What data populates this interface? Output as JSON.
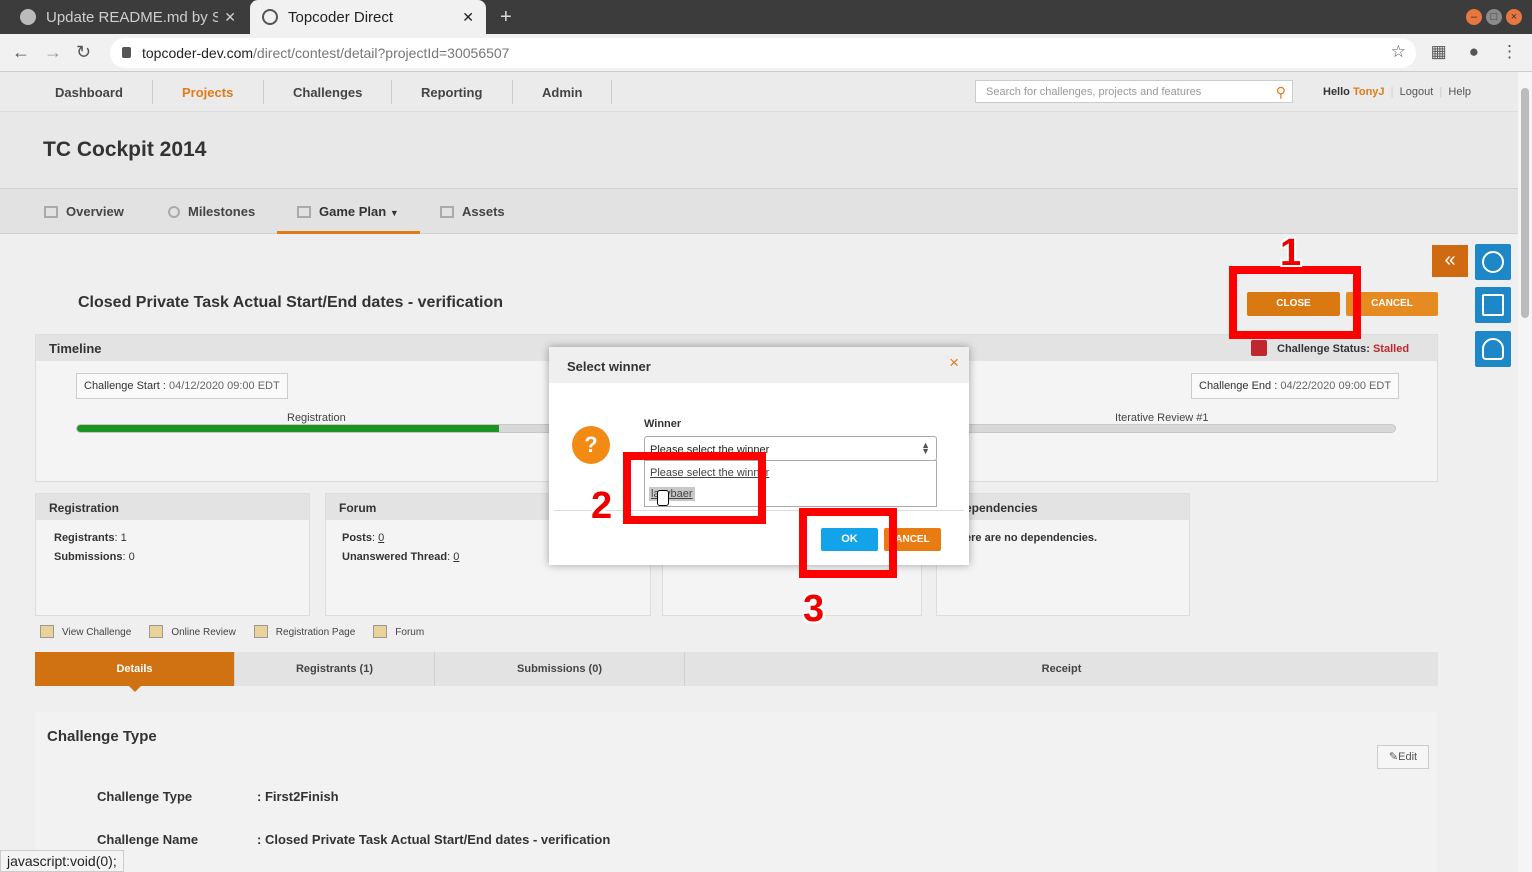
{
  "browser": {
    "tabs": [
      {
        "label": "Update README.md by S",
        "active": false
      },
      {
        "label": "Topcoder Direct",
        "active": true
      }
    ],
    "url_host": "topcoder-dev.com",
    "url_path": "/direct/contest/detail?projectId=30056507",
    "status_url": "javascript:void(0);"
  },
  "topnav": {
    "items": [
      "Dashboard",
      "Projects",
      "Challenges",
      "Reporting",
      "Admin"
    ],
    "search_placeholder": "Search for challenges, projects and features",
    "hello": "Hello",
    "user": "TonyJ",
    "logout": "Logout",
    "help": "Help"
  },
  "project_title": "TC Cockpit 2014",
  "subnav": [
    "Overview",
    "Milestones",
    "Game Plan",
    "Assets"
  ],
  "challenge": {
    "title": "Closed Private Task Actual Start/End dates - verification",
    "close_label": "CLOSE",
    "cancel_label": "CANCEL",
    "status_label": "Challenge Status:",
    "status_value": "Stalled"
  },
  "timeline": {
    "header": "Timeline",
    "start_label": "Challenge Start :",
    "start_value": "04/12/2020 09:00 EDT",
    "end_label": "Challenge End :",
    "end_value": "04/22/2020 09:00 EDT",
    "phase_left": "Registration",
    "phase_right": "Iterative Review #1",
    "progress": 0.32
  },
  "boxes": {
    "registration": {
      "header": "Registration",
      "registrants_label": "Registrants",
      "registrants": ": 1",
      "submissions_label": "Submissions",
      "submissions": ": 0"
    },
    "forum": {
      "header": "Forum",
      "posts_label": "Posts",
      "posts": "0",
      "unanswered_label": "Unanswered Thread",
      "unanswered": "0"
    },
    "dependencies": {
      "header": "ependencies",
      "text": "ere are no dependencies."
    }
  },
  "actions": [
    "View Challenge",
    "Online Review",
    "Registration Page",
    "Forum"
  ],
  "detail_tabs": [
    "Details",
    "Registrants (1)",
    "Submissions (0)",
    "Receipt"
  ],
  "details": {
    "header": "Challenge Type",
    "edit_label": "Edit",
    "rows": [
      {
        "label": "Challenge Type",
        "value": ": First2Finish"
      },
      {
        "label": "Challenge Name",
        "value": ": Closed Private Task Actual Start/End dates - verification"
      }
    ]
  },
  "modal": {
    "title": "Select winner",
    "close_glyph": "×",
    "question_glyph": "?",
    "winner_label": "Winner",
    "select_value": "Please select the winner",
    "options": [
      "Please select the winner",
      "lazybaer"
    ],
    "ok_label": "OK",
    "cancel_label": "ANCEL"
  },
  "annotations": [
    "1",
    "2",
    "3"
  ]
}
